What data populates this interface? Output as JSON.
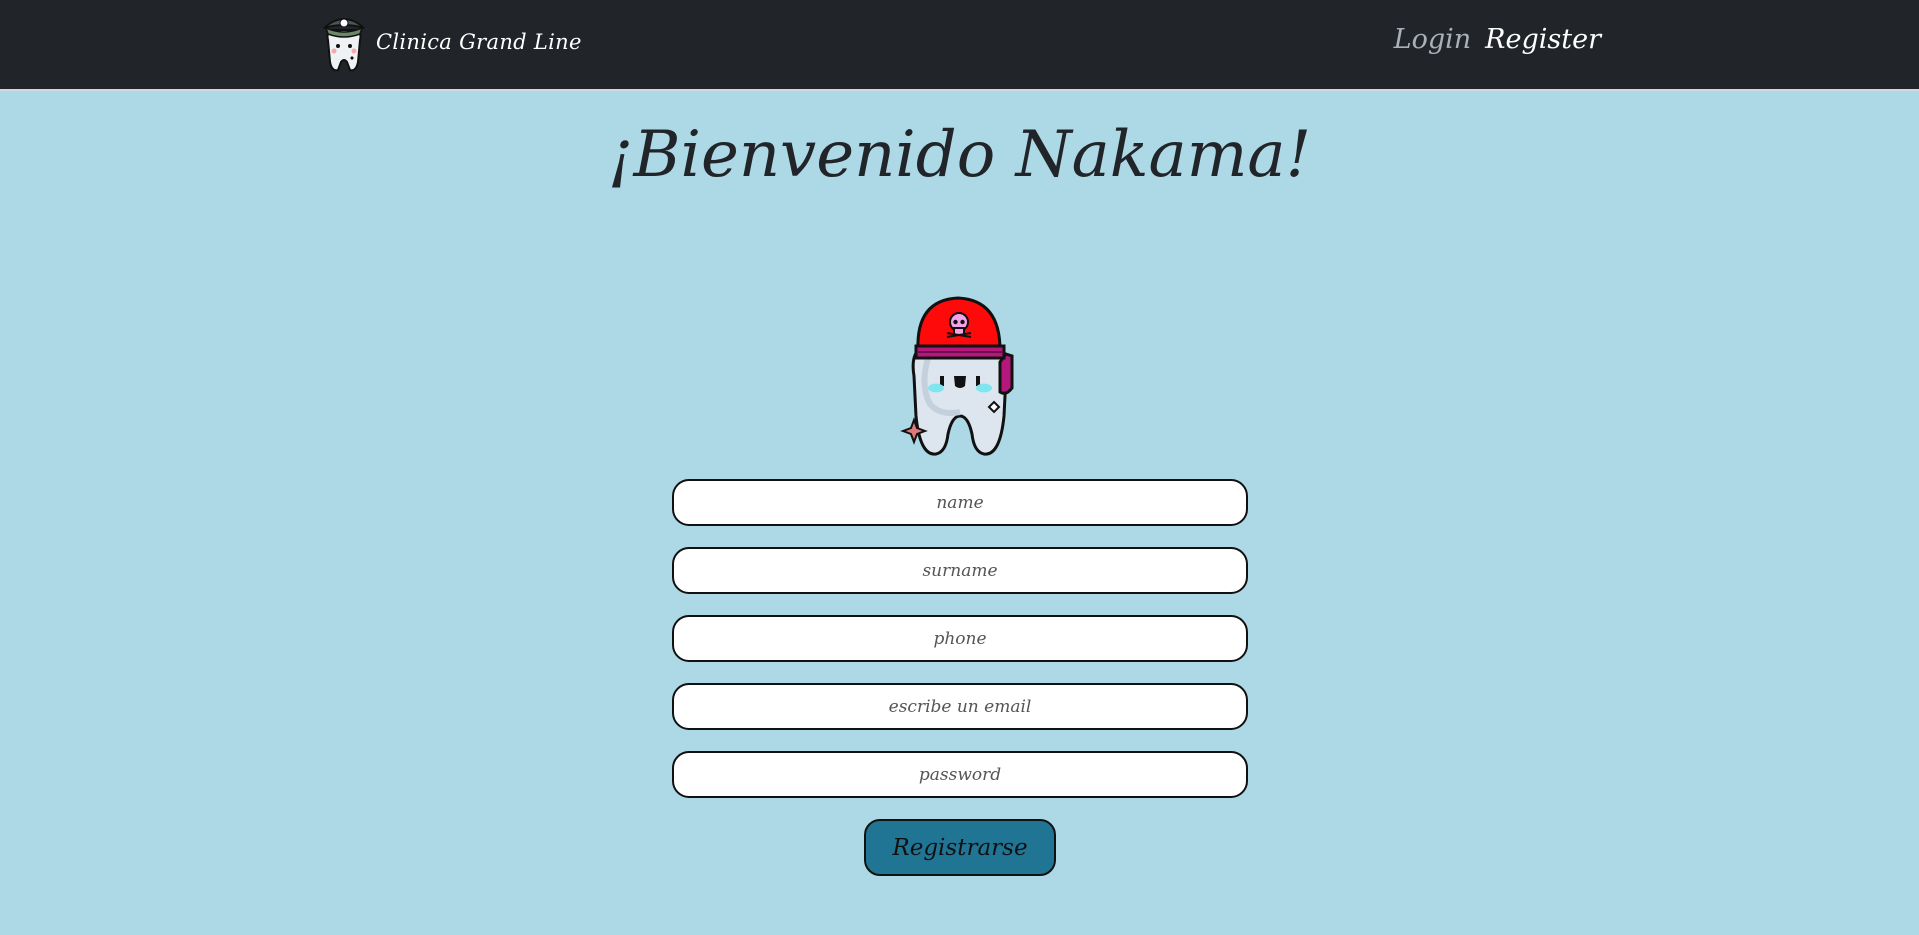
{
  "navbar": {
    "brand_name": "Clinica Grand Line",
    "logo_icon": "pirate-tooth-logo-icon",
    "login_label": "Login",
    "register_label": "Register"
  },
  "main": {
    "title": "¡Bienvenido Nakama!",
    "mascot_icon": "pirate-tooth-mascot-icon",
    "form": {
      "name_placeholder": "name",
      "surname_placeholder": "surname",
      "phone_placeholder": "phone",
      "email_placeholder": "escribe un email",
      "password_placeholder": "password",
      "submit_label": "Registrarse"
    }
  },
  "colors": {
    "page_background": "#add8e6",
    "navbar_background": "#212529",
    "button_background": "#207595",
    "bandana_red": "#ff0a0a"
  }
}
